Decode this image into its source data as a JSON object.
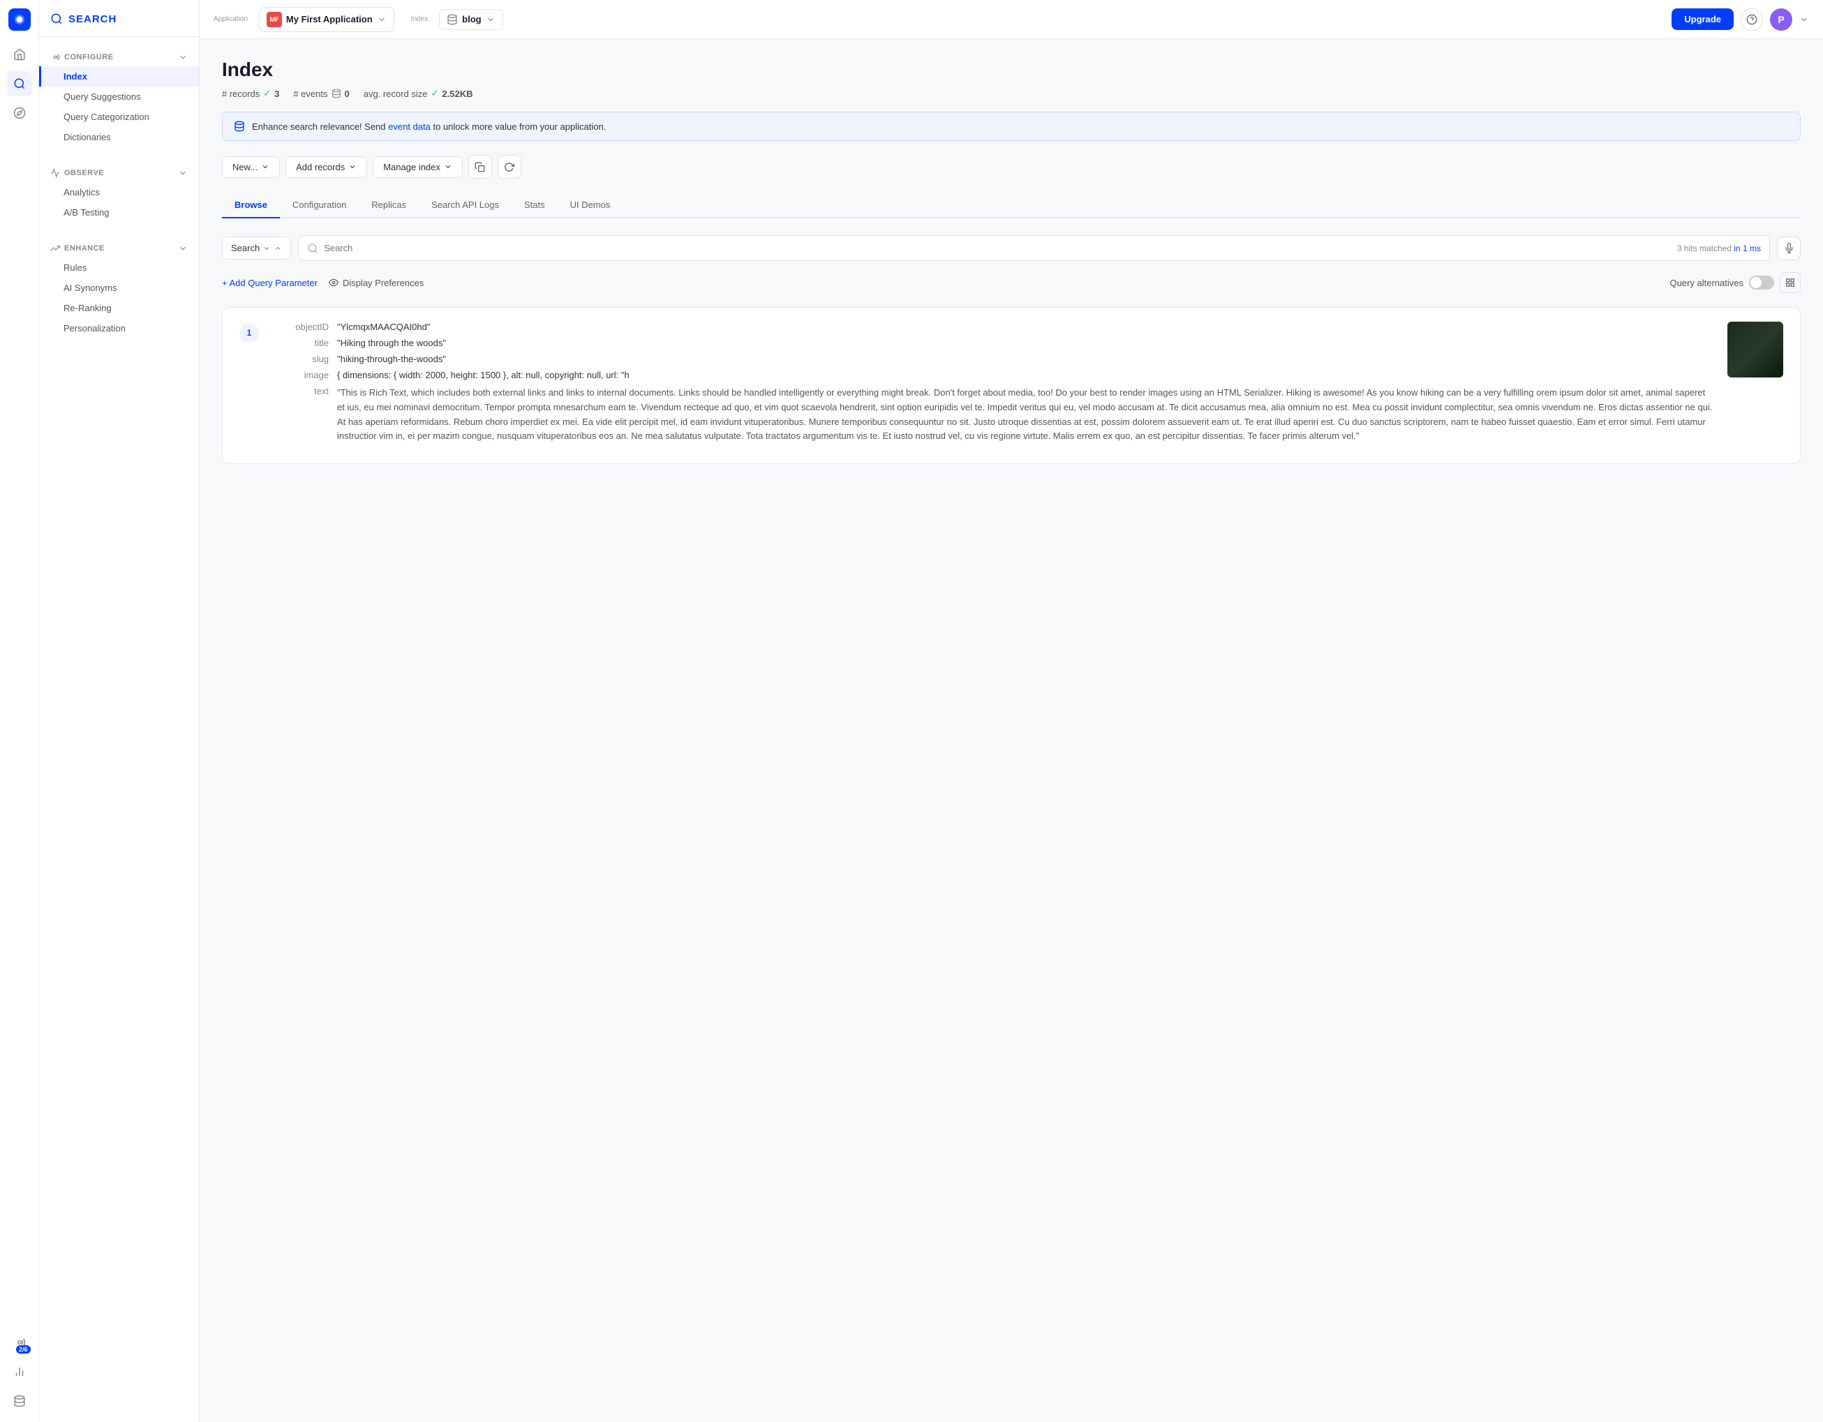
{
  "appShell": {
    "logoText": "SEARCH"
  },
  "topbar": {
    "appLabel": "Application",
    "appName": "My First Application",
    "appInitials": "MF",
    "indexLabel": "Index",
    "indexName": "blog",
    "upgradeBtn": "Upgrade",
    "userInitial": "P"
  },
  "sidebar": {
    "sections": [
      {
        "id": "configure",
        "label": "CONFIGURE",
        "items": [
          {
            "id": "index",
            "label": "Index",
            "active": true
          },
          {
            "id": "query-suggestions",
            "label": "Query Suggestions",
            "active": false
          },
          {
            "id": "query-categorization",
            "label": "Query Categorization",
            "active": false
          },
          {
            "id": "dictionaries",
            "label": "Dictionaries",
            "active": false
          }
        ]
      },
      {
        "id": "observe",
        "label": "OBSERVE",
        "items": [
          {
            "id": "analytics",
            "label": "Analytics",
            "active": false
          },
          {
            "id": "ab-testing",
            "label": "A/B Testing",
            "active": false
          }
        ]
      },
      {
        "id": "enhance",
        "label": "ENHANCE",
        "items": [
          {
            "id": "rules",
            "label": "Rules",
            "active": false
          },
          {
            "id": "ai-synonyms",
            "label": "AI Synonyms",
            "active": false
          },
          {
            "id": "re-ranking",
            "label": "Re-Ranking",
            "active": false
          },
          {
            "id": "personalization",
            "label": "Personalization",
            "active": false
          }
        ]
      }
    ]
  },
  "page": {
    "title": "Index",
    "stats": {
      "recordsLabel": "# records",
      "recordsCount": "3",
      "eventsLabel": "# events",
      "eventsCount": "0",
      "avgSizeLabel": "avg. record size",
      "avgSizeValue": "2.52KB"
    },
    "infoBanner": "Enhance search relevance! Send event data to unlock more value from your application.",
    "infoBannerLinkText": "event data",
    "toolbar": {
      "newBtn": "New...",
      "addRecordsBtn": "Add records",
      "manageIndexBtn": "Manage index"
    },
    "tabs": [
      {
        "id": "browse",
        "label": "Browse",
        "active": true
      },
      {
        "id": "configuration",
        "label": "Configuration",
        "active": false
      },
      {
        "id": "replicas",
        "label": "Replicas",
        "active": false
      },
      {
        "id": "search-api-logs",
        "label": "Search API Logs",
        "active": false
      },
      {
        "id": "stats",
        "label": "Stats",
        "active": false
      },
      {
        "id": "ui-demos",
        "label": "UI Demos",
        "active": false
      }
    ],
    "searchType": "Search",
    "searchPlaceholder": "Search",
    "hitsMatched": "3 hits matched",
    "hitsMatchedSuffix": "in 1 ms",
    "addQueryParam": "+ Add Query Parameter",
    "displayPreferences": "Display Preferences",
    "queryAlternatives": "Query alternatives",
    "records": [
      {
        "number": 1,
        "fields": [
          {
            "name": "objectID",
            "value": "\"YlcmqxMAACQAI0hd\""
          },
          {
            "name": "title",
            "value": "\"Hiking through the woods\""
          },
          {
            "name": "slug",
            "value": "\"hiking-through-the-woods\""
          },
          {
            "name": "image",
            "value": "{ dimensions: { width: 2000, height: 1500 }, alt: null, copyright: null, url: \"h"
          },
          {
            "name": "text",
            "value": "\"This is Rich Text, which includes both external links and links to internal documents. Links should be handled intelligently or everything might break. Don't forget about media, too! Do your best to render images using an HTML Serializer. Hiking is awesome! As you know hiking can be a very fulfilling orem ipsum dolor sit amet, animal saperet et ius, eu mei nominavi democritum. Tempor prompta mnesarchum eam te. Vivendum recteque ad quo, et vim quot scaevola hendrerit, sint option euripidis vel te. Impedit veritus qui eu, vel modo accusam at. Te dicit accusamus mea, alia omnium no est. Mea cu possit invidunt complectitur, sea omnis vivendum ne. Eros dictas assentior ne qui. At has aperiam reformidans. Rebum choro imperdiet ex mei. Ea vide elit percipit mel, id eam invidunt vituperatoribus. Munere temporibus consequuntur no sit. Justo utroque dissentias at est, possim dolorem assueverit eam ut. Te erat illud aperiri est. Cu duo sanctus scriptorem, nam te habeo fuisset quaestio. Eam et error simul. Ferri utamur instructior vim in, ei per mazim congue, nusquam vituperatoribus eos an. Ne mea salutatus vulputate. Tota tractatos argumentum vis te. Et iusto nostrud vel, cu vis regione virtute. Malis errem ex quo, an est percipitur dissentias. Te facer primis alterum vel.\""
          }
        ]
      }
    ]
  }
}
